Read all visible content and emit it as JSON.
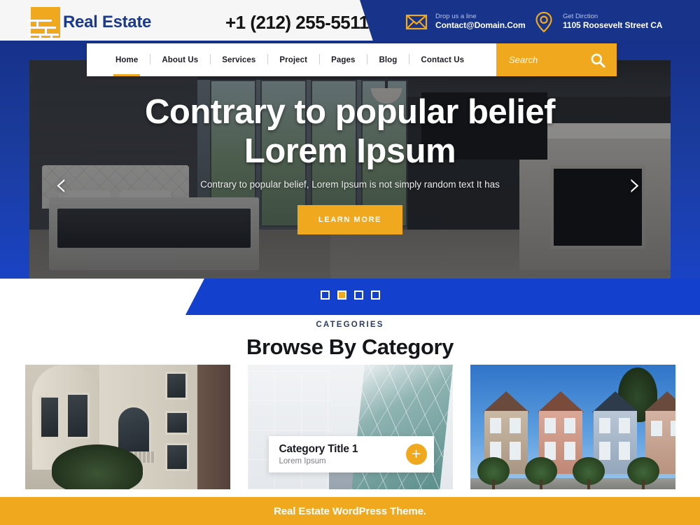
{
  "header": {
    "logo_text": "Real Estate",
    "logo_icon": "brick-wall-icon",
    "phone": "+1 (212) 255-5511",
    "mail": {
      "icon": "envelope-icon",
      "label": "Drop us a line",
      "value": "Contact@Domain.Com"
    },
    "location": {
      "icon": "map-pin-icon",
      "label": "Get Dirction",
      "value": "1105 Roosevelt Street CA"
    },
    "colors": {
      "blue": "#17348a",
      "amber": "#f0a81e"
    }
  },
  "nav": {
    "items": [
      {
        "label": "Home",
        "active": true
      },
      {
        "label": "About Us",
        "active": false
      },
      {
        "label": "Services",
        "active": false
      },
      {
        "label": "Project",
        "active": false
      },
      {
        "label": "Pages",
        "active": false
      },
      {
        "label": "Blog",
        "active": false
      },
      {
        "label": "Contact Us",
        "active": false
      }
    ],
    "search": {
      "placeholder": "Search",
      "value": "",
      "icon": "search-icon"
    }
  },
  "hero": {
    "title_line1": "Contrary to popular belief",
    "title_line2": "Lorem Ipsum",
    "subtitle": "Contrary to popular belief, Lorem Ipsum is not simply random text It has",
    "cta_label": "LEARN MORE",
    "prev_icon": "chevron-left-icon",
    "next_icon": "chevron-right-icon",
    "slides_total": 4,
    "active_slide": 2
  },
  "categories": {
    "eyebrow": "CATEGORIES",
    "title": "Browse By Category",
    "cards": [
      {
        "overlay": false,
        "title": "",
        "subtitle": ""
      },
      {
        "overlay": true,
        "title": "Category Title 1",
        "subtitle": "Lorem Ipsum",
        "plus_icon": "plus-icon"
      },
      {
        "overlay": false,
        "title": "",
        "subtitle": ""
      }
    ]
  },
  "footer": {
    "text": "Real Estate WordPress Theme."
  }
}
